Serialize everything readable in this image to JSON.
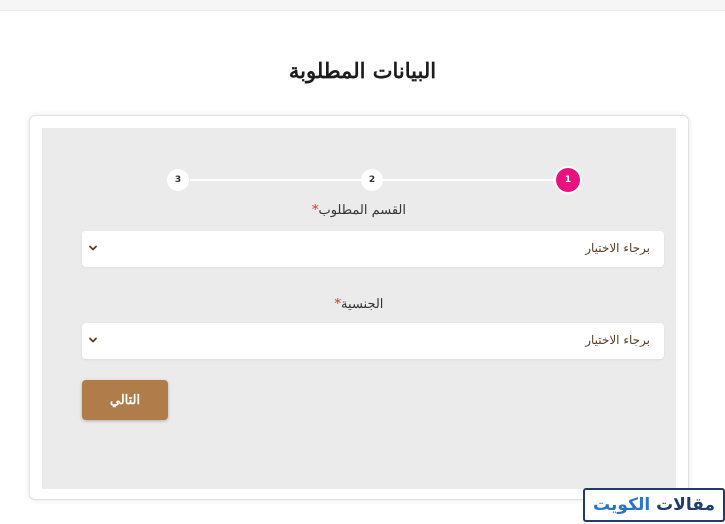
{
  "page": {
    "title": "البيانات المطلوبة"
  },
  "stepper": {
    "steps": [
      {
        "label": "1",
        "active": true
      },
      {
        "label": "2",
        "active": false
      },
      {
        "label": "3",
        "active": false
      }
    ],
    "active_color": "#e8117f"
  },
  "form": {
    "department": {
      "label": "القسم المطلوب",
      "required_mark": "*",
      "value": "برجاء الاختيار"
    },
    "nationality": {
      "label": "الجنسية",
      "required_mark": "*",
      "value": "برجاء الاختيار"
    },
    "next_button": {
      "label": "التالي",
      "color": "#b07c4a"
    }
  },
  "watermark": {
    "part1": "مقالات",
    "part2": "الكويت"
  }
}
